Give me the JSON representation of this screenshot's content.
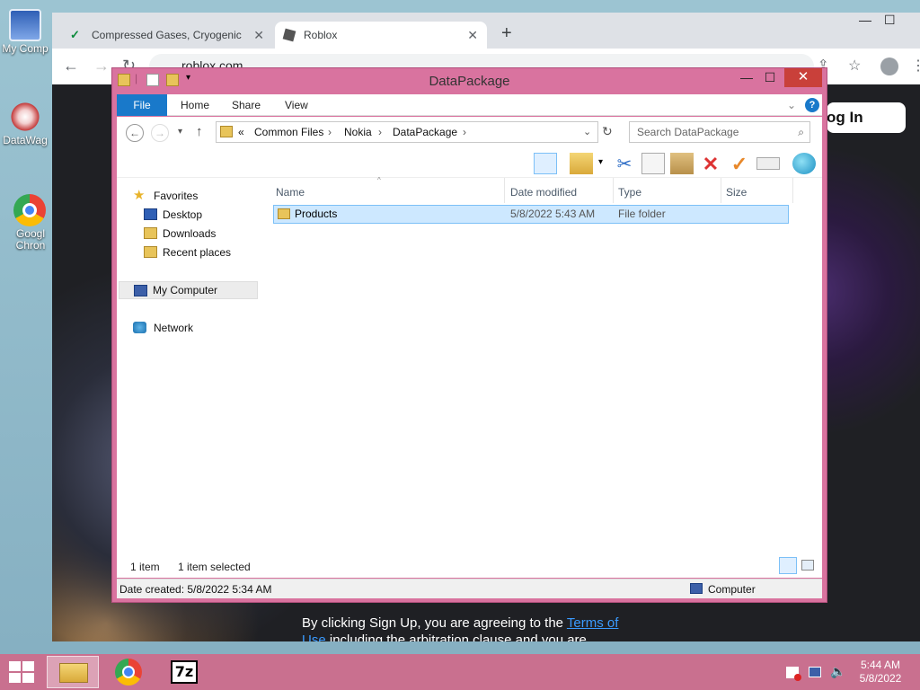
{
  "desktop": {
    "icons": [
      {
        "label": "My Comp"
      },
      {
        "label": "DataWag"
      },
      {
        "label": "Googl Chron"
      }
    ]
  },
  "browser": {
    "tabs": [
      {
        "label": "Compressed Gases, Cryogenic Li"
      },
      {
        "label": "Roblox"
      }
    ],
    "new_tab": "+",
    "url": "roblox.com",
    "page": {
      "login_button": "og In",
      "signup_text": "By clicking Sign Up, you are agreeing to the",
      "terms_link": "Terms of",
      "signup_text_line2_link": "Use",
      "signup_text_line2": "including the arbitration clause and you are"
    }
  },
  "explorer": {
    "title": "DataPackage",
    "ribbon_tabs": [
      "File",
      "Home",
      "Share",
      "View"
    ],
    "breadcrumb": {
      "prefix": "«",
      "parts": [
        "Common Files",
        "Nokia",
        "DataPackage"
      ]
    },
    "search_placeholder": "Search DataPackage",
    "nav": {
      "favorites": "Favorites",
      "desktop": "Desktop",
      "downloads": "Downloads",
      "recent": "Recent places",
      "my_computer": "My Computer",
      "network": "Network"
    },
    "columns": {
      "name": "Name",
      "date": "Date modified",
      "type": "Type",
      "size": "Size"
    },
    "files": [
      {
        "name": "Products",
        "date": "5/8/2022 5:43 AM",
        "type": "File folder",
        "size": ""
      }
    ],
    "status": {
      "count": "1 item",
      "selected": "1 item selected"
    },
    "details": {
      "created": "Date created: 5/8/2022 5:34 AM",
      "location": "Computer"
    }
  },
  "taskbar": {
    "time": "5:44 AM",
    "date": "5/8/2022",
    "seven_zip_label": "7z"
  },
  "colors": {
    "window_frame": "#d9739f",
    "taskbar": "#c9708f",
    "file_tab": "#1979ca",
    "selection": "#cde8ff",
    "close_button": "#c9403a"
  }
}
